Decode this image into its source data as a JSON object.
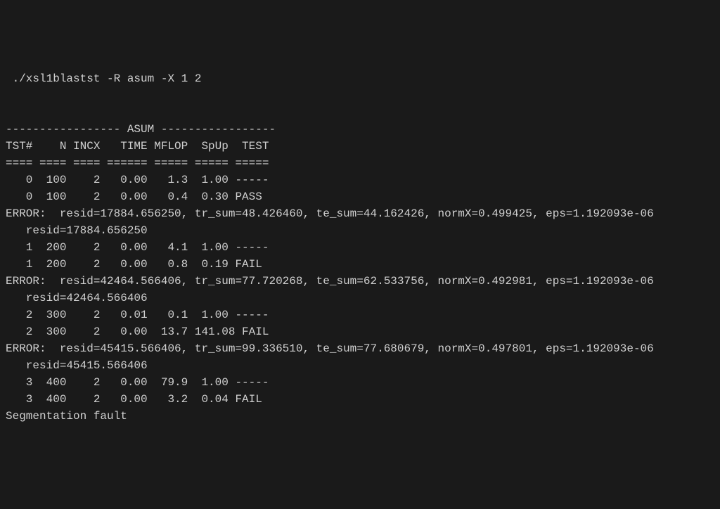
{
  "command": " ./xsl1blastst -R asum -X 1 2",
  "blank": "",
  "header_divider": "----------------- ASUM -----------------",
  "column_headers": "TST#    N INCX   TIME MFLOP  SpUp  TEST",
  "header_underline": "==== ==== ==== ====== ===== ===== =====",
  "rows": {
    "r0a": "   0  100    2   0.00   1.3  1.00 -----",
    "r0b": "   0  100    2   0.00   0.4  0.30 PASS",
    "err1a": "ERROR:  resid=17884.656250, tr_sum=48.426460, te_sum=44.162426, normX=0.499425, eps=1.192093e-06",
    "err1b": "   resid=17884.656250",
    "r1a": "   1  200    2   0.00   4.1  1.00 -----",
    "r1b": "   1  200    2   0.00   0.8  0.19 FAIL",
    "err2a": "ERROR:  resid=42464.566406, tr_sum=77.720268, te_sum=62.533756, normX=0.492981, eps=1.192093e-06",
    "err2b": "   resid=42464.566406",
    "r2a": "   2  300    2   0.01   0.1  1.00 -----",
    "r2b": "   2  300    2   0.00  13.7 141.08 FAIL",
    "err3a": "ERROR:  resid=45415.566406, tr_sum=99.336510, te_sum=77.680679, normX=0.497801, eps=1.192093e-06",
    "err3b": "   resid=45415.566406",
    "r3a": "   3  400    2   0.00  79.9  1.00 -----",
    "r3b": "   3  400    2   0.00   3.2  0.04 FAIL"
  },
  "segfault": "Segmentation fault"
}
